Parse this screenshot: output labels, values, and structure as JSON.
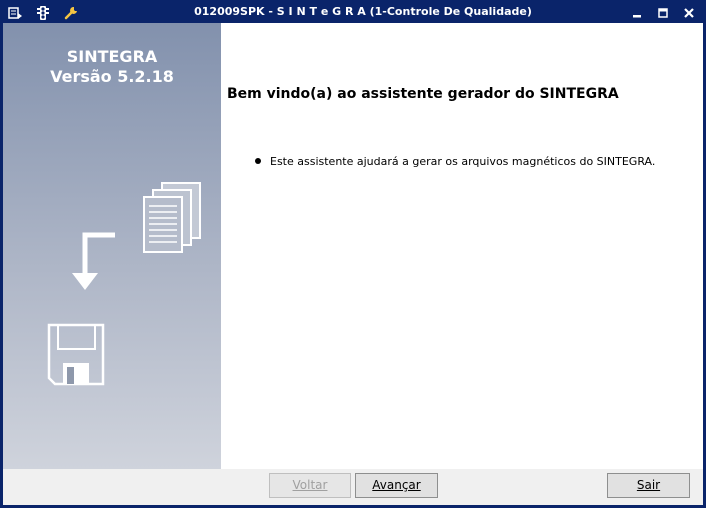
{
  "window": {
    "title": "012009SPK - S I N T e G R A (1-Controle De Qualidade)",
    "colors": {
      "titlebar": "#0a246a",
      "sidebar_top": "#8291ad",
      "sidebar_bottom": "#cfd3dc"
    }
  },
  "titlebar_icons": [
    "menu-icon",
    "traffic-light-icon",
    "wrench-icon"
  ],
  "window_controls": [
    "minimize-icon",
    "maximize-icon",
    "close-icon"
  ],
  "sidebar": {
    "app_name": "SINTEGRA",
    "version": "Versão 5.2.18",
    "illustration": [
      "documents-icon",
      "arrow-down-icon",
      "floppy-disk-icon"
    ]
  },
  "main": {
    "heading": "Bem vindo(a) ao assistente gerador do SINTEGRA",
    "bullets": [
      "Este assistente ajudará a gerar os arquivos magnéticos do SINTEGRA."
    ]
  },
  "footer": {
    "back_label": "Voltar",
    "back_enabled": false,
    "next_label": "Avançar",
    "exit_label": "Sair"
  }
}
